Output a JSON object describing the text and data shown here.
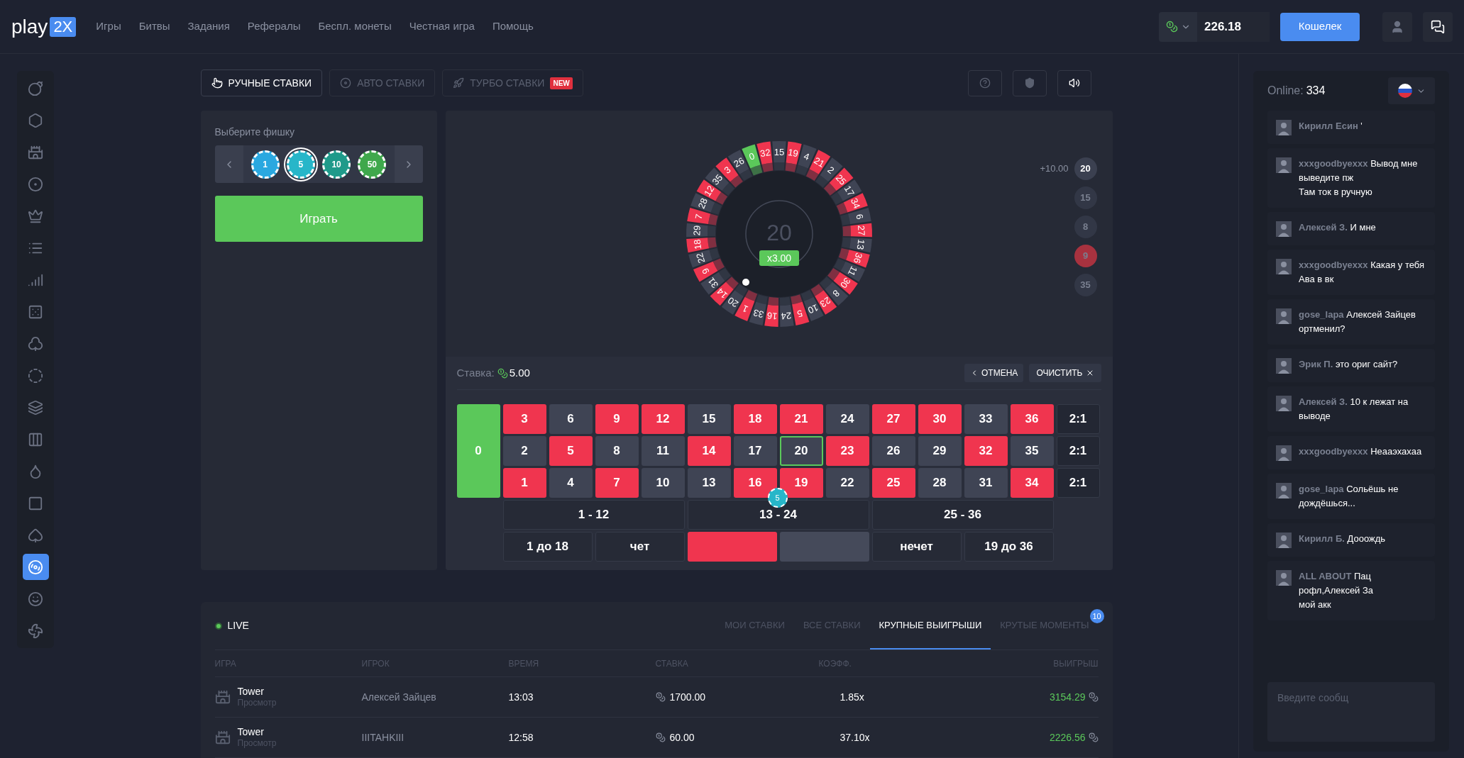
{
  "header": {
    "logo": {
      "text": "play",
      "badge": "2X"
    },
    "nav": [
      "Игры",
      "Битвы",
      "Задания",
      "Рефералы",
      "Беспл. монеты",
      "Честная игра",
      "Помощь"
    ],
    "balance": "226.18",
    "wallet_button": "Кошелек"
  },
  "sidebar": {
    "items": [
      {
        "kind": "bomb",
        "selected": false
      },
      {
        "kind": "hexagon",
        "selected": false
      },
      {
        "kind": "castle",
        "selected": false
      },
      {
        "kind": "target",
        "selected": false
      },
      {
        "kind": "crown",
        "selected": false
      },
      {
        "kind": "ladder",
        "selected": false
      },
      {
        "kind": "chart",
        "selected": false
      },
      {
        "kind": "dice",
        "selected": false
      },
      {
        "kind": "club",
        "selected": false
      },
      {
        "kind": "dashed",
        "selected": false
      },
      {
        "kind": "cards",
        "selected": false
      },
      {
        "kind": "slots",
        "selected": false
      },
      {
        "kind": "drop",
        "selected": false
      },
      {
        "kind": "square",
        "selected": false
      },
      {
        "kind": "spade",
        "selected": false
      },
      {
        "kind": "roulette",
        "selected": true
      },
      {
        "kind": "smile",
        "selected": false
      },
      {
        "kind": "fan",
        "selected": false
      }
    ]
  },
  "mode_tabs": [
    {
      "kind": "hand",
      "label": "РУЧНЫЕ СТАВКИ",
      "selected": true
    },
    {
      "kind": "disc",
      "label": "АВТО СТАВКИ",
      "selected": false
    },
    {
      "kind": "rocket",
      "label": "ТУРБО СТАВКИ",
      "selected": false,
      "badge": "NEW"
    }
  ],
  "chip_picker": {
    "title": "Выберите фишку",
    "chips": [
      {
        "value": "1",
        "color": "#2aa8e0",
        "selected": false
      },
      {
        "value": "5",
        "color": "#27b6c9",
        "selected": true
      },
      {
        "value": "10",
        "color": "#1f9a8a",
        "selected": false
      },
      {
        "value": "50",
        "color": "#3fa84c",
        "selected": false
      }
    ]
  },
  "play_button": "Играть",
  "wheel": {
    "result": "20",
    "multiplier": "x3.00",
    "pockets": [
      {
        "number": "0",
        "color": "#5bc85a"
      },
      {
        "number": "32",
        "color": "#f0354f"
      },
      {
        "number": "15",
        "color": "#3f4454"
      },
      {
        "number": "19",
        "color": "#f0354f"
      },
      {
        "number": "4",
        "color": "#3f4454"
      },
      {
        "number": "21",
        "color": "#f0354f"
      },
      {
        "number": "2",
        "color": "#3f4454"
      },
      {
        "number": "25",
        "color": "#f0354f"
      },
      {
        "number": "17",
        "color": "#3f4454"
      },
      {
        "number": "34",
        "color": "#f0354f"
      },
      {
        "number": "6",
        "color": "#3f4454"
      },
      {
        "number": "27",
        "color": "#f0354f"
      },
      {
        "number": "13",
        "color": "#3f4454"
      },
      {
        "number": "36",
        "color": "#f0354f"
      },
      {
        "number": "11",
        "color": "#3f4454"
      },
      {
        "number": "30",
        "color": "#f0354f"
      },
      {
        "number": "8",
        "color": "#3f4454"
      },
      {
        "number": "23",
        "color": "#f0354f"
      },
      {
        "number": "10",
        "color": "#3f4454"
      },
      {
        "number": "5",
        "color": "#f0354f"
      },
      {
        "number": "24",
        "color": "#3f4454"
      },
      {
        "number": "16",
        "color": "#f0354f"
      },
      {
        "number": "33",
        "color": "#3f4454"
      },
      {
        "number": "1",
        "color": "#f0354f"
      },
      {
        "number": "20",
        "color": "#3f4454"
      },
      {
        "number": "14",
        "color": "#f0354f"
      },
      {
        "number": "31",
        "color": "#3f4454"
      },
      {
        "number": "9",
        "color": "#f0354f"
      },
      {
        "number": "22",
        "color": "#3f4454"
      },
      {
        "number": "18",
        "color": "#f0354f"
      },
      {
        "number": "29",
        "color": "#3f4454"
      },
      {
        "number": "7",
        "color": "#f0354f"
      },
      {
        "number": "28",
        "color": "#3f4454"
      },
      {
        "number": "12",
        "color": "#f0354f"
      },
      {
        "number": "35",
        "color": "#3f4454"
      },
      {
        "number": "3",
        "color": "#f0354f"
      },
      {
        "number": "26",
        "color": "#3f4454"
      }
    ]
  },
  "history": {
    "gain": "+10.00",
    "results": [
      {
        "number": "20",
        "color": "#3b4050",
        "selected": true
      },
      {
        "number": "15",
        "color": "#323746",
        "selected": false
      },
      {
        "number": "8",
        "color": "#323746",
        "selected": false
      },
      {
        "number": "9",
        "color": "#a8323f",
        "selected": false
      },
      {
        "number": "35",
        "color": "#323746",
        "selected": false
      }
    ]
  },
  "bet": {
    "label": "Ставка:",
    "amount": "5.00",
    "undo": "ОТМЕНА",
    "clear": "ОЧИСТИТЬ"
  },
  "board": {
    "zero": "0",
    "numbers": [
      {
        "number": "3",
        "color": "#f0354f",
        "selected": false
      },
      {
        "number": "6",
        "color": "#3f4454",
        "selected": false
      },
      {
        "number": "9",
        "color": "#f0354f",
        "selected": false
      },
      {
        "number": "12",
        "color": "#f0354f",
        "selected": false
      },
      {
        "number": "15",
        "color": "#3f4454",
        "selected": false
      },
      {
        "number": "18",
        "color": "#f0354f",
        "selected": false
      },
      {
        "number": "21",
        "color": "#f0354f",
        "selected": false
      },
      {
        "number": "24",
        "color": "#3f4454",
        "selected": false
      },
      {
        "number": "27",
        "color": "#f0354f",
        "selected": false
      },
      {
        "number": "30",
        "color": "#f0354f",
        "selected": false
      },
      {
        "number": "33",
        "color": "#3f4454",
        "selected": false
      },
      {
        "number": "36",
        "color": "#f0354f",
        "selected": false
      },
      {
        "number": "2",
        "color": "#3f4454",
        "selected": false
      },
      {
        "number": "5",
        "color": "#f0354f",
        "selected": false
      },
      {
        "number": "8",
        "color": "#3f4454",
        "selected": false
      },
      {
        "number": "11",
        "color": "#3f4454",
        "selected": false
      },
      {
        "number": "14",
        "color": "#f0354f",
        "selected": false
      },
      {
        "number": "17",
        "color": "#3f4454",
        "selected": false
      },
      {
        "number": "20",
        "color": "#3f4454",
        "selected": true
      },
      {
        "number": "23",
        "color": "#f0354f",
        "selected": false
      },
      {
        "number": "26",
        "color": "#3f4454",
        "selected": false
      },
      {
        "number": "29",
        "color": "#3f4454",
        "selected": false
      },
      {
        "number": "32",
        "color": "#f0354f",
        "selected": false
      },
      {
        "number": "35",
        "color": "#3f4454",
        "selected": false
      },
      {
        "number": "1",
        "color": "#f0354f",
        "selected": false
      },
      {
        "number": "4",
        "color": "#3f4454",
        "selected": false
      },
      {
        "number": "7",
        "color": "#f0354f",
        "selected": false
      },
      {
        "number": "10",
        "color": "#3f4454",
        "selected": false
      },
      {
        "number": "13",
        "color": "#3f4454",
        "selected": false
      },
      {
        "number": "16",
        "color": "#f0354f",
        "selected": false
      },
      {
        "number": "19",
        "color": "#f0354f",
        "selected": false
      },
      {
        "number": "22",
        "color": "#3f4454",
        "selected": false
      },
      {
        "number": "25",
        "color": "#f0354f",
        "selected": false
      },
      {
        "number": "28",
        "color": "#3f4454",
        "selected": false
      },
      {
        "number": "31",
        "color": "#3f4454",
        "selected": false
      },
      {
        "number": "34",
        "color": "#f0354f",
        "selected": false
      }
    ],
    "columns": [
      "2:1",
      "2:1",
      "2:1"
    ],
    "dozens": [
      {
        "label": "1 - 12"
      },
      {
        "label": "13 - 24",
        "chip": "5"
      },
      {
        "label": "25 - 36"
      }
    ],
    "outside": [
      {
        "kind": "text",
        "label": "1 до 18"
      },
      {
        "kind": "text",
        "label": "чет"
      },
      {
        "kind": "color",
        "color": "#f0354f"
      },
      {
        "kind": "color",
        "color": "#454a5a"
      },
      {
        "kind": "text",
        "label": "нечет"
      },
      {
        "kind": "text",
        "label": "19 до 36"
      }
    ]
  },
  "live": {
    "label": "LIVE",
    "tabs": [
      {
        "label": "МОИ СТАВКИ",
        "selected": false
      },
      {
        "label": "ВСЕ СТАВКИ",
        "selected": false
      },
      {
        "label": "КРУПНЫЕ ВЫИГРЫШИ",
        "selected": true
      },
      {
        "label": "КРУТЫЕ МОМЕНТЫ",
        "selected": false,
        "badge": "10"
      }
    ],
    "columns": [
      "ИГРА",
      "ИГРОК",
      "ВРЕМЯ",
      "СТАВКА",
      "КОЭФФ.",
      "ВЫИГРЫШ"
    ],
    "rows": [
      {
        "game": "Tower",
        "sub": "Просмотр",
        "player": "Алексей Зайцев",
        "time": "13:03",
        "bet": "1700.00",
        "coef": "1.85x",
        "win": "3154.29"
      },
      {
        "game": "Tower",
        "sub": "Просмотр",
        "player": "IIITAHKIII",
        "time": "12:58",
        "bet": "60.00",
        "coef": "37.10x",
        "win": "2226.56"
      }
    ]
  },
  "chat": {
    "online_label": "Online:",
    "online_count": "334",
    "messages": [
      {
        "user": "Кирилл Есин",
        "text": "'"
      },
      {
        "user": "xxxgoodbyexxx",
        "text": "Вывод мне выведите пж\nТам ток в ручную"
      },
      {
        "user": "Алексей З.",
        "text": "И мне"
      },
      {
        "user": "xxxgoodbyexxx",
        "text": "Какая у тебя Ава в вк"
      },
      {
        "user": "gose_lapa",
        "text": "Алексей Зайцев ортменил?"
      },
      {
        "user": "Эрик П.",
        "text": "это ориг сайт?"
      },
      {
        "user": "Алексей З.",
        "text": "10 к лежат на выводе"
      },
      {
        "user": "xxxgoodbyexxx",
        "text": "Неааэхахаа"
      },
      {
        "user": "gose_lapa",
        "text": "Сольёшь не дождёшься..."
      },
      {
        "user": "Кирилл Б.",
        "text": "Дооождь"
      },
      {
        "user": "ALL ABOUT",
        "text": "Пац\nрофл,Алексей За\nмой акк"
      }
    ],
    "input": {
      "placeholder": "Введите сообщ"
    }
  }
}
